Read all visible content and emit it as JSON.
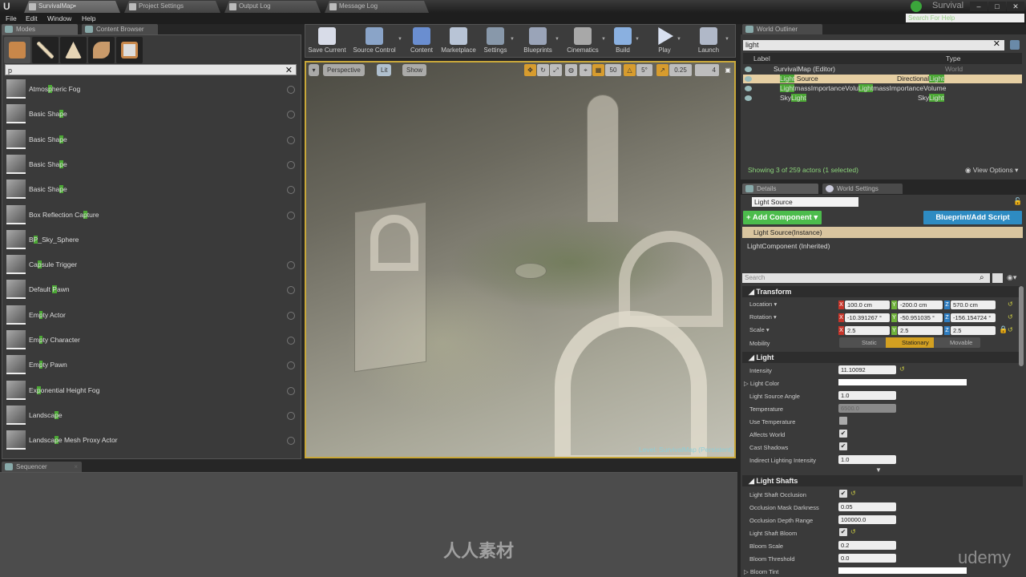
{
  "window": {
    "doc_tabs": [
      {
        "label": "SurvivalMap•",
        "active": true
      },
      {
        "label": "Project Settings",
        "active": false
      },
      {
        "label": "Output Log",
        "active": false
      },
      {
        "label": "Message Log",
        "active": false
      }
    ],
    "project_name": "Survival",
    "help_search_placeholder": "Search For Help",
    "controls": {
      "minimize": "–",
      "maximize": "□",
      "close": "✕"
    }
  },
  "menu": [
    "File",
    "Edit",
    "Window",
    "Help"
  ],
  "modes_panel": {
    "tabs": [
      "Modes",
      "Content Browser"
    ],
    "mode_icons": [
      "place-mode-icon",
      "paint-mode-icon",
      "landscape-mode-icon",
      "foliage-mode-icon",
      "geometry-mode-icon"
    ],
    "search_value": "p",
    "items": [
      {
        "pre": "Atmos",
        "hl": "p",
        "post": "heric Fog"
      },
      {
        "pre": "Basic Sha",
        "hl": "p",
        "post": "e"
      },
      {
        "pre": "Basic Sha",
        "hl": "p",
        "post": "e"
      },
      {
        "pre": "Basic Sha",
        "hl": "p",
        "post": "e"
      },
      {
        "pre": "Basic Sha",
        "hl": "p",
        "post": "e"
      },
      {
        "pre": "Box Reflection Ca",
        "hl": "p",
        "post": "ture"
      },
      {
        "pre": "B",
        "hl": "P",
        "post": "_Sky_Sphere"
      },
      {
        "pre": "Ca",
        "hl": "p",
        "post": "sule Trigger"
      },
      {
        "pre": "Default ",
        "hl": "P",
        "post": "awn"
      },
      {
        "pre": "Em",
        "hl": "p",
        "post": "ty Actor"
      },
      {
        "pre": "Em",
        "hl": "p",
        "post": "ty Character"
      },
      {
        "pre": "Em",
        "hl": "p",
        "post": "ty Pawn"
      },
      {
        "pre": "Ex",
        "hl": "p",
        "post": "onential Height Fog"
      },
      {
        "pre": "Landsca",
        "hl": "p",
        "post": "e"
      },
      {
        "pre": "Landsca",
        "hl": "p",
        "post": "e Mesh Proxy Actor"
      }
    ]
  },
  "toolbar": {
    "buttons": [
      {
        "label": "Save Current",
        "icon": "save-icon",
        "dropdown": false
      },
      {
        "label": "Source Control",
        "icon": "source-control-icon",
        "dropdown": true
      },
      {
        "label": "Content",
        "icon": "content-icon",
        "dropdown": false
      },
      {
        "label": "Marketplace",
        "icon": "marketplace-icon",
        "dropdown": false
      },
      {
        "label": "Settings",
        "icon": "settings-icon",
        "dropdown": true
      },
      {
        "label": "Blueprints",
        "icon": "blueprints-icon",
        "dropdown": true
      },
      {
        "label": "Cinematics",
        "icon": "cinematics-icon",
        "dropdown": true
      },
      {
        "label": "Build",
        "icon": "build-icon",
        "dropdown": true
      },
      {
        "label": "Play",
        "icon": "play-icon",
        "dropdown": true
      },
      {
        "label": "Launch",
        "icon": "launch-icon",
        "dropdown": true
      }
    ]
  },
  "viewport": {
    "view_mode": "Perspective",
    "lighting": "Lit",
    "show": "Show",
    "grid_snap": "50",
    "rotation_snap": "5°",
    "scale_snap": "0.25",
    "camera_speed": "4",
    "level_label": "Level: SurvivalMap (Persistent)"
  },
  "sequencer": {
    "tab": "Sequencer"
  },
  "outliner": {
    "tab": "World Outliner",
    "search_value": "light",
    "columns": [
      "Label",
      "Type"
    ],
    "root": {
      "label": "SurvivalMap (Editor)",
      "type": "World"
    },
    "rows": [
      {
        "name_hl": "Light",
        "name_rest": " Source",
        "type_pre": "Directional",
        "type_hl": "Light",
        "selected": true
      },
      {
        "name_hl": "Light",
        "name_rest": "massImportanceVolu",
        "type_pre": "",
        "type_hl": "Light",
        "type_post": "massImportanceVolume",
        "selected": false
      },
      {
        "name_pre": "Sky",
        "name_hl": "Light",
        "type_pre": "Sky",
        "type_hl": "Light",
        "selected": false
      }
    ],
    "status": "Showing 3 of 259 actors (1 selected)",
    "view_options": "View Options"
  },
  "details": {
    "tabs": [
      "Details",
      "World Settings"
    ],
    "actor_name": "Light Source",
    "add_component": "+ Add Component",
    "blueprint_script": "Blueprint/Add Script",
    "component_instance": "Light Source(Instance)",
    "component_inherited": "LightComponent (Inherited)",
    "search_placeholder": "Search",
    "transform": {
      "title": "Transform",
      "location_label": "Location",
      "location": [
        "100.0 cm",
        "-200.0 cm",
        "570.0 cm"
      ],
      "rotation_label": "Rotation",
      "rotation": [
        "-10.391267 °",
        "-50.951035 °",
        "-156.154724 °"
      ],
      "scale_label": "Scale",
      "scale": [
        "2.5",
        "2.5",
        "2.5"
      ],
      "mobility_label": "Mobility",
      "mobility_options": [
        "Static",
        "Stationary",
        "Movable"
      ],
      "mobility_selected": "Stationary"
    },
    "light": {
      "title": "Light",
      "intensity_label": "Intensity",
      "intensity": "11.10092",
      "light_color_label": "Light Color",
      "source_angle_label": "Light Source Angle",
      "source_angle": "1.0",
      "temperature_label": "Temperature",
      "temperature": "6500.0",
      "use_temperature_label": "Use Temperature",
      "use_temperature": false,
      "affects_world_label": "Affects World",
      "affects_world": true,
      "cast_shadows_label": "Cast Shadows",
      "cast_shadows": true,
      "indirect_label": "Indirect Lighting Intensity",
      "indirect": "1.0"
    },
    "light_shafts": {
      "title": "Light Shafts",
      "occlusion_label": "Light Shaft Occlusion",
      "occlusion": true,
      "mask_darkness_label": "Occlusion Mask Darkness",
      "mask_darkness": "0.05",
      "depth_range_label": "Occlusion Depth Range",
      "depth_range": "100000.0",
      "bloom_label": "Light Shaft Bloom",
      "bloom": true,
      "bloom_scale_label": "Bloom Scale",
      "bloom_scale": "0.2",
      "bloom_threshold_label": "Bloom Threshold",
      "bloom_threshold": "0.0",
      "bloom_tint_label": "Bloom Tint"
    }
  },
  "overlay": {
    "udemy": "udemy",
    "watermark": "人人素材"
  }
}
